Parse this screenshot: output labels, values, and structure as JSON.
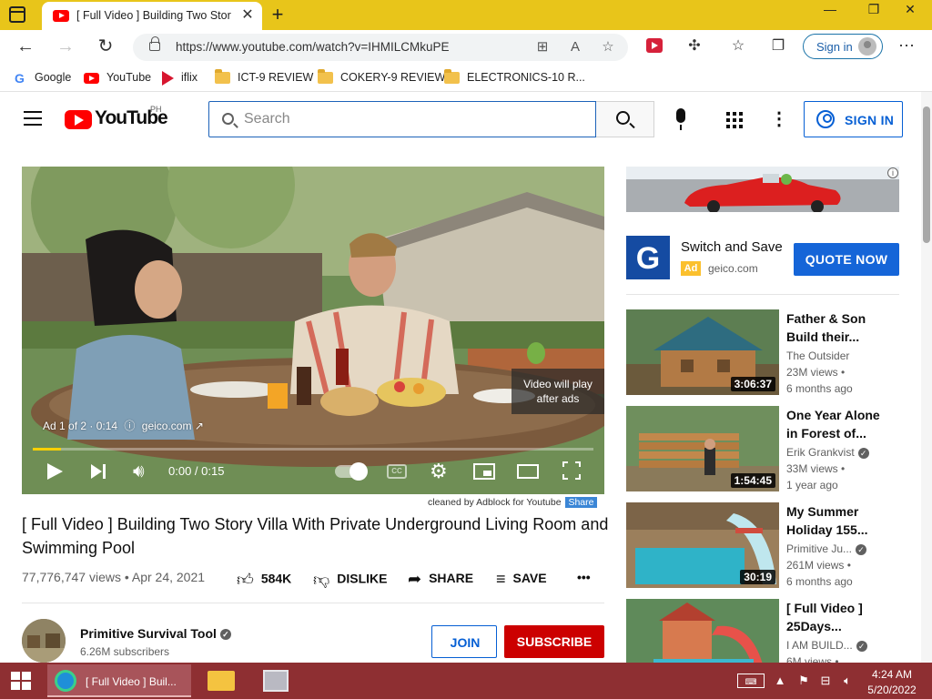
{
  "browser": {
    "tab_title": "[ Full Video ] Building Two Story Villa With Private Underground Living Room and Swimming Pool",
    "tab_close": "✕",
    "new_tab": "+",
    "url": "https://www.youtube.com/watch?v=IHMILCMkuPE",
    "signin_label": "Sign in",
    "minimize": "—",
    "restore": "❐",
    "close": "✕"
  },
  "bookmarks": [
    {
      "label": "Google",
      "icon": "google-icon"
    },
    {
      "label": "YouTube",
      "icon": "youtube-icon"
    },
    {
      "label": "iflix",
      "icon": "iflix-icon"
    },
    {
      "label": "ICT-9 REVIEW",
      "icon": "folder-icon"
    },
    {
      "label": "COKERY-9 REVIEW",
      "icon": "folder-icon"
    },
    {
      "label": "ELECTRONICS-10 R...",
      "icon": "folder-icon"
    }
  ],
  "youtube": {
    "logo_text": "YouTube",
    "country": "PH",
    "search_placeholder": "Search",
    "signin_label": "SIGN IN"
  },
  "player": {
    "skip_line1": "Video will play",
    "skip_line2": "after ads",
    "ad_count": "Ad 1 of 2 · 0:14",
    "ad_domain": "geico.com",
    "time": "0:00 / 0:15",
    "progress": 0.05,
    "cc_label": "CC",
    "accent_color": "#fcd000"
  },
  "adblock": {
    "note": "cleaned by Adblock for Youtube",
    "share": "Share"
  },
  "video": {
    "title": "[ Full Video ] Building Two Story Villa With Private Underground Living Room and Swimming Pool",
    "views_date": "77,776,747 views • Apr 24, 2021",
    "likes": "584K",
    "dislike": "DISLIKE",
    "share": "SHARE",
    "save": "SAVE",
    "more": "•••"
  },
  "channel": {
    "name": "Primitive Survival Tool",
    "subscribers": "6.26M subscribers",
    "join": "JOIN",
    "subscribe": "SUBSCRIBE",
    "subscribe_color": "#cc0000"
  },
  "ad": {
    "title": "Switch and Save",
    "badge": "Ad",
    "domain": "geico.com",
    "logo_letter": "G",
    "cta": "QUOTE NOW",
    "info": "i"
  },
  "recommendations": [
    {
      "title": "Father & Son Build their...",
      "channel": "The Outsider",
      "verified": false,
      "views": "23M views •",
      "age": "6 months ago",
      "duration": "3:06:37"
    },
    {
      "title": "One Year Alone in Forest of...",
      "channel": "Erik Grankvist",
      "verified": true,
      "views": "33M views •",
      "age": "1 year ago",
      "duration": "1:54:45"
    },
    {
      "title": "My Summer Holiday 155...",
      "channel": "Primitive Ju...",
      "verified": true,
      "views": "261M views •",
      "age": "6 months ago",
      "duration": "30:19"
    },
    {
      "title": "[ Full Video ] 25Days...",
      "channel": "I AM BUILD...",
      "verified": true,
      "views": "6M views •",
      "age": "",
      "duration": ""
    }
  ],
  "taskbar": {
    "edge_label": "[ Full Video ] Buil...",
    "time": "4:24 AM",
    "date": "5/20/2022"
  }
}
